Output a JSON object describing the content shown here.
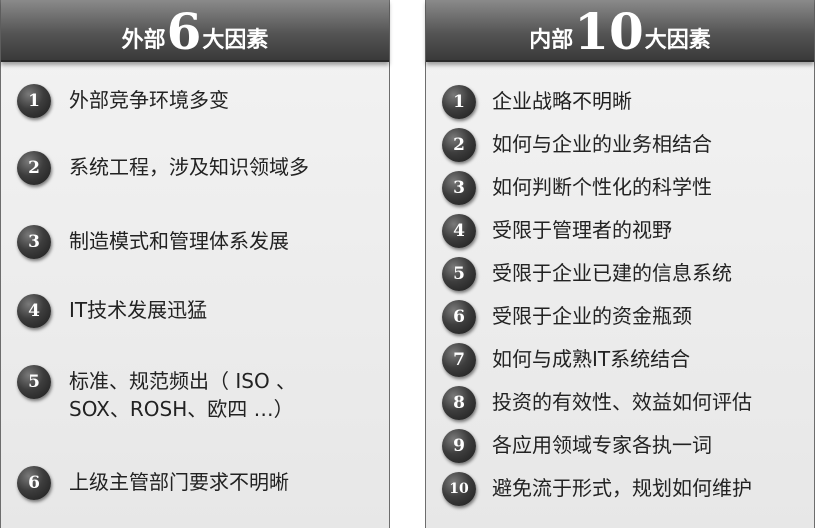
{
  "external": {
    "title_pre": "外部",
    "title_num": "6",
    "title_post": "大因素",
    "items": [
      {
        "num": "1",
        "text": "外部竞争环境多变"
      },
      {
        "num": "2",
        "text": "系统工程，涉及知识领域多"
      },
      {
        "num": "3",
        "text": "制造模式和管理体系发展"
      },
      {
        "num": "4",
        "text": "IT技术发展迅猛"
      },
      {
        "num": "5",
        "text": "标准、规范频出（ ISO 、SOX、ROSH、欧四 …）"
      },
      {
        "num": "6",
        "text": "上级主管部门要求不明晰"
      }
    ]
  },
  "internal": {
    "title_pre": "内部",
    "title_num": "10",
    "title_post": "大因素",
    "items": [
      {
        "num": "1",
        "text": "企业战略不明晰"
      },
      {
        "num": "2",
        "text": "如何与企业的业务相结合"
      },
      {
        "num": "3",
        "text": "如何判断个性化的科学性"
      },
      {
        "num": "4",
        "text": "受限于管理者的视野"
      },
      {
        "num": "5",
        "text": "受限于企业已建的信息系统"
      },
      {
        "num": "6",
        "text": "受限于企业的资金瓶颈"
      },
      {
        "num": "7",
        "text": "如何与成熟IT系统结合"
      },
      {
        "num": "8",
        "text": "投资的有效性、效益如何评估"
      },
      {
        "num": "9",
        "text": "各应用领域专家各执一词"
      },
      {
        "num": "10",
        "text": "避免流于形式，规划如何维护"
      }
    ]
  }
}
